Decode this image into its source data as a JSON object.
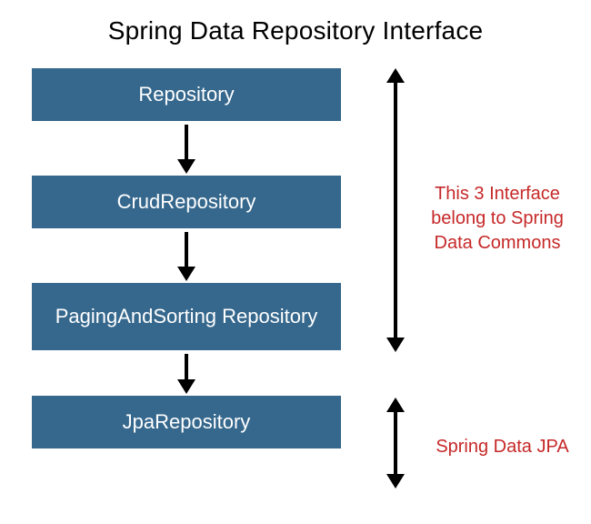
{
  "title": "Spring Data Repository Interface",
  "boxes": [
    {
      "label": "Repository"
    },
    {
      "label": "CrudRepository"
    },
    {
      "label": "PagingAndSorting Repository"
    },
    {
      "label": "JpaRepository"
    }
  ],
  "annotations": {
    "commons": "This 3 Interface belong to Spring Data Commons",
    "jpa": "Spring Data JPA"
  },
  "colors": {
    "box": "#36688d",
    "annotation": "#c62828"
  }
}
